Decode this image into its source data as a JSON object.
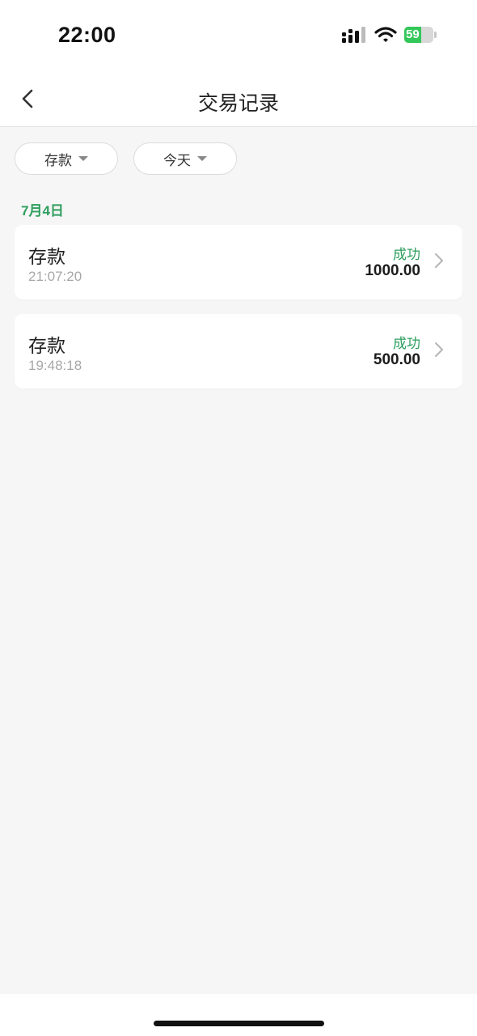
{
  "status_bar": {
    "time": "22:00",
    "battery_level": "59",
    "battery_fraction": 0.59
  },
  "nav": {
    "title": "交易记录"
  },
  "filters": [
    {
      "label": "存款"
    },
    {
      "label": "今天"
    }
  ],
  "date_group": "7月4日",
  "transactions": [
    {
      "type": "存款",
      "time": "21:07:20",
      "status": "成功",
      "amount": "1000.00"
    },
    {
      "type": "存款",
      "time": "19:48:18",
      "status": "成功",
      "amount": "500.00"
    }
  ],
  "colors": {
    "accent_green": "#2e9e5e",
    "battery_green": "#34c759"
  },
  "icons": [
    "back-chevron-icon",
    "dropdown-caret-icon",
    "chevron-right-icon",
    "signal-icon",
    "wifi-icon",
    "battery-icon"
  ]
}
